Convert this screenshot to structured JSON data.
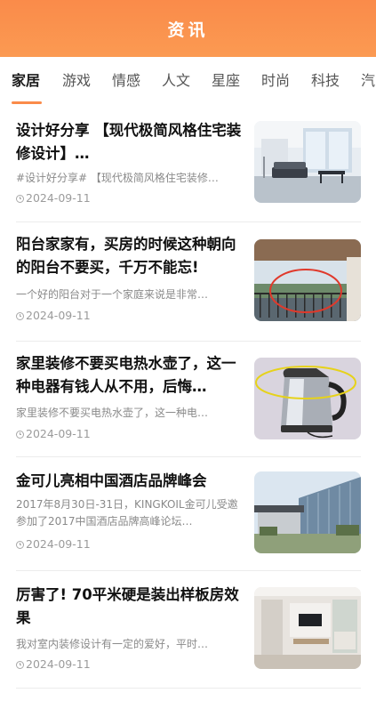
{
  "header": {
    "title": "资讯"
  },
  "tabs": [
    "家居",
    "游戏",
    "情感",
    "人文",
    "星座",
    "时尚",
    "科技",
    "汽"
  ],
  "active_tab": "家居",
  "colors": {
    "accent": "#fa8b4a",
    "header_gradient_end": "#fb9a52"
  },
  "articles": [
    {
      "title": "设计好分享 【现代极简风格住宅装修设计】…",
      "summary": "#设计好分享# 【现代极简风格住宅装修…",
      "date": "2024-09-11",
      "image": "modern-living-room-photo"
    },
    {
      "title": "阳台家家有，买房的时候这种朝向的阳台不要买，千万不能忘!",
      "summary": "一个好的阳台对于一个家庭来说是非常…",
      "date": "2024-09-11",
      "image": "balcony-photo"
    },
    {
      "title": "家里装修不要买电热水壶了，这一种电器有钱人从不用，后悔…",
      "summary": "家里装修不要买电热水壶了，这一种电…",
      "date": "2024-09-11",
      "image": "electric-kettle-photo"
    },
    {
      "title": "金可儿亮相中国酒店品牌峰会",
      "summary": "2017年8月30日-31日，KINGKOIL金可儿受邀参加了2017中国酒店品牌高峰论坛…",
      "date": "2024-09-11",
      "image": "hotel-building-photo"
    },
    {
      "title": "厉害了! 70平米硬是装出样板房效果",
      "summary": "我对室内装修设计有一定的爱好，平时…",
      "date": "2024-09-11",
      "image": "living-room-tv-wall-photo"
    }
  ]
}
